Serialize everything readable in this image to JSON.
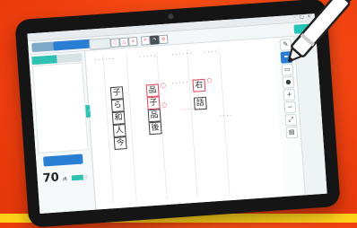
{
  "app": {
    "title": "",
    "buttons": {
      "left_a": "",
      "left_b": "",
      "finish": ""
    }
  },
  "panel": {
    "tabs": [
      "",
      ""
    ],
    "criteria": [
      "",
      "",
      "",
      "",
      ""
    ],
    "score_button": "",
    "score": {
      "value": "70",
      "unit": "点",
      "fill_fraction": 0.7
    }
  },
  "sheet": {
    "boxes_col1": [
      "子",
      "ら",
      "和",
      "人",
      "今"
    ],
    "boxes_col2": [
      "品",
      "子",
      "品",
      "後"
    ],
    "boxes_col3": [
      "右",
      "話"
    ],
    "ok_marks": [
      "○",
      "○",
      "○"
    ]
  },
  "tools": {
    "items": [
      "pen-icon",
      "marker-icon",
      "eraser-icon",
      "stamp-icon",
      "zoom-in-icon",
      "zoom-out-icon",
      "fit-icon",
      "page-icon"
    ]
  },
  "colors": {
    "accent_teal": "#2fc2b3",
    "accent_blue": "#2a7fd4",
    "mark_red": "#e0485f",
    "background_orange": "#f04010"
  }
}
